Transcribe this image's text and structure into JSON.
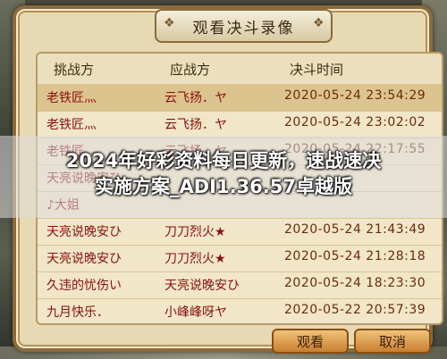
{
  "dialog": {
    "title": "观看决斗录像",
    "columns": [
      "挑战方",
      "应战方",
      "决斗时间"
    ],
    "rows": [
      {
        "challenger": "老铁匠灬",
        "defender": "云飞扬．ヤ",
        "time": "2020-05-24 23:54:29"
      },
      {
        "challenger": "老铁匠灬",
        "defender": "云飞扬．ヤ",
        "time": "2020-05-24 23:02:02"
      },
      {
        "challenger": "老铁匠灬",
        "defender": "云飞扬．ヤ",
        "time": "2020-05-24 22:17:55"
      },
      {
        "challenger": "天亮说晚安ひ",
        "defender": "",
        "time": ""
      },
      {
        "challenger": "♪大姐",
        "defender": "",
        "time": ""
      },
      {
        "challenger": "天亮说晚安ひ",
        "defender": "刀刀烈火★",
        "time": "2020-05-24 21:43:49"
      },
      {
        "challenger": "天亮说晚安ひ",
        "defender": "刀刀烈火★",
        "time": "2020-05-24 21:28:18"
      },
      {
        "challenger": "久违的忧伤い",
        "defender": "天亮说晚安ひ",
        "time": "2020-05-24 18:23:30"
      },
      {
        "challenger": "九月快乐．",
        "defender": "小峰峰呀ヤ",
        "time": "2020-05-22 20:57:39"
      }
    ],
    "buttons": {
      "watch": "观看",
      "cancel": "取消"
    }
  },
  "overlay": {
    "line1": "2024年好彩资料每日更新，速战速决",
    "line2": "实施方案_ADI1.36.57卓越版"
  }
}
